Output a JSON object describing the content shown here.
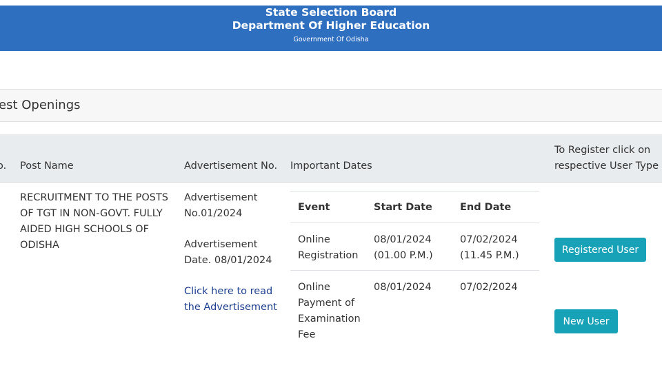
{
  "header": {
    "title": "State Selection Board",
    "subtitle": "Department Of Higher Education",
    "government": "Government Of Odisha"
  },
  "section": {
    "title": "est Openings"
  },
  "table": {
    "columns": {
      "sl_no": "o.",
      "post_name": "Post Name",
      "advertisement_no": "Advertisement No.",
      "important_dates": "Important Dates",
      "register_line1": "To Register click on",
      "register_line2": "respective User Type"
    },
    "row": {
      "post_name": "RECRUITMENT TO THE POSTS OF TGT IN NON-GOVT. FULLY AIDED HIGH SCHOOLS OF ODISHA",
      "advertisement_no": "Advertisement No.01/2024",
      "advertisement_date": "Advertisement Date. 08/01/2024",
      "advertisement_link": "Click here to read the Advertisement"
    },
    "dates": {
      "headers": {
        "event": "Event",
        "start": "Start Date",
        "end": "End Date"
      },
      "rows": [
        {
          "event": "Online Registration",
          "start": "08/01/2024 (01.00 P.M.)",
          "end": "07/02/2024 (11.45 P.M.)"
        },
        {
          "event": "Online Payment of Examination Fee",
          "start": "08/01/2024",
          "end": "07/02/2024"
        }
      ]
    }
  },
  "buttons": {
    "registered_user": "Registered User",
    "new_user": "New User"
  },
  "colors": {
    "header_bg": "#2f6fc0",
    "button_bg": "#17a2b8",
    "link": "#1d3f8f"
  }
}
